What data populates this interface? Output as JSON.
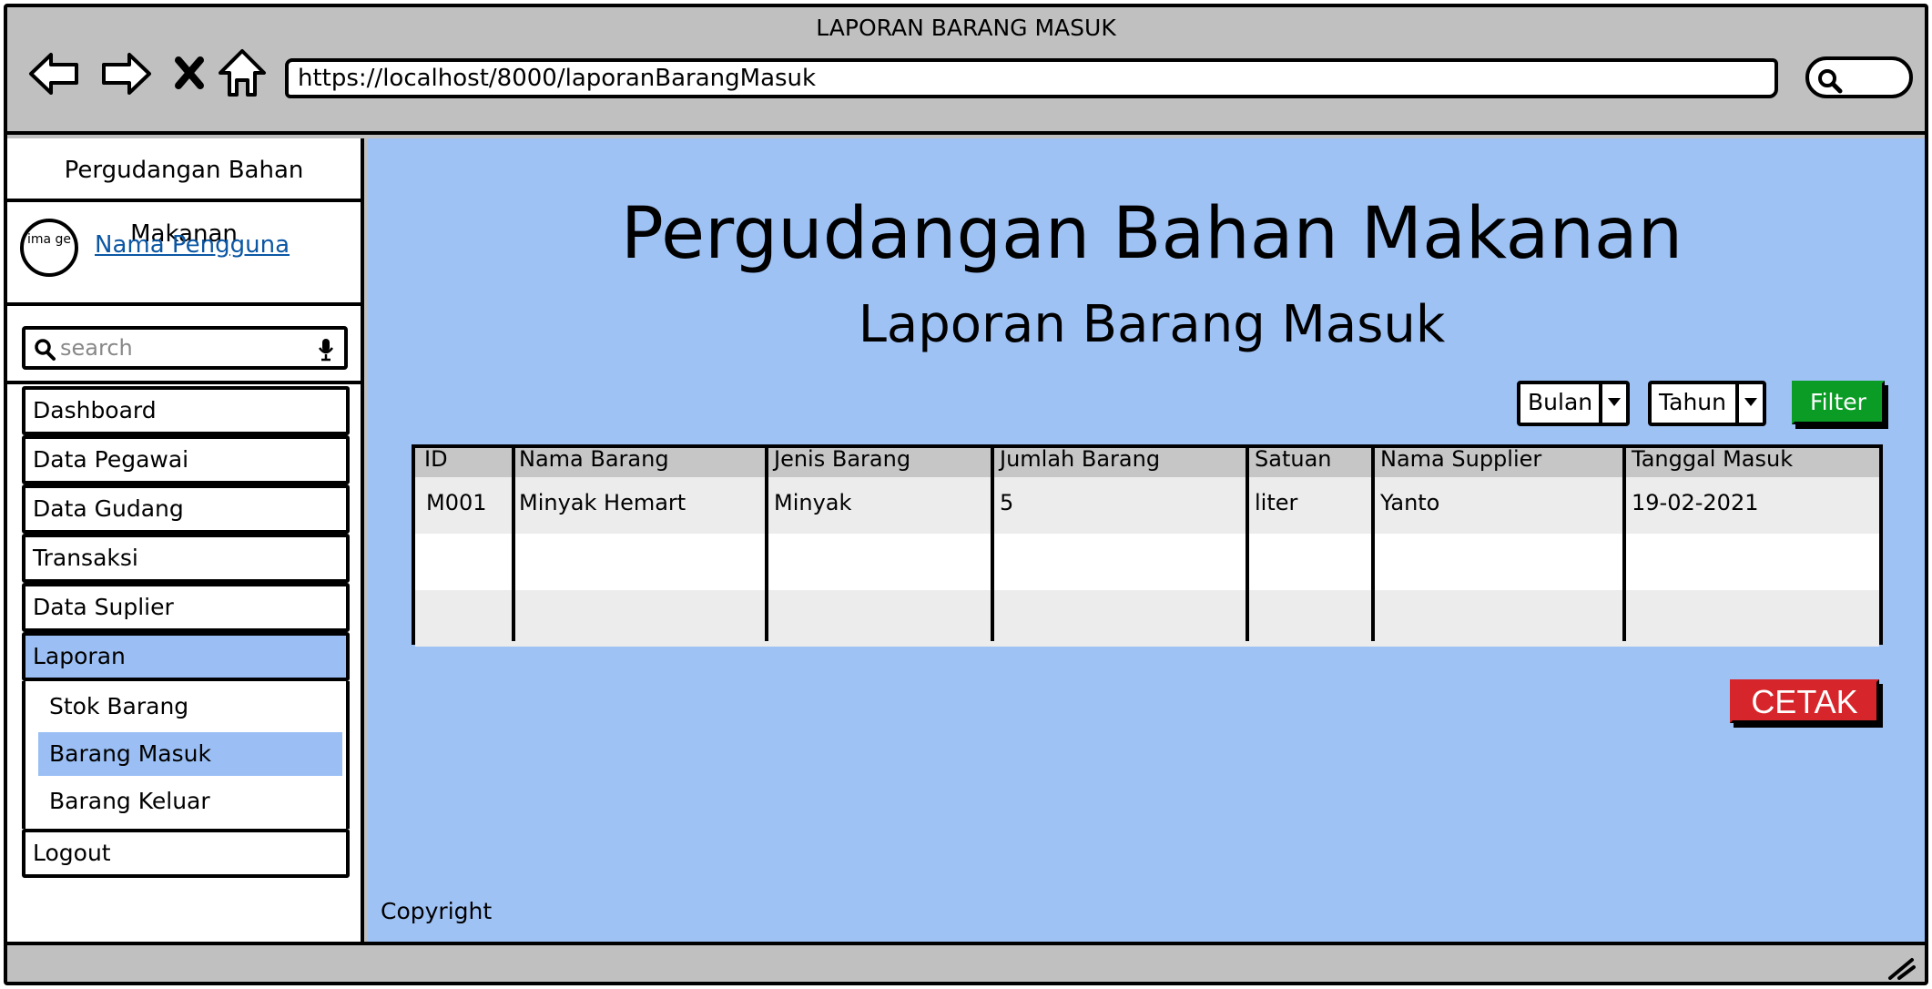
{
  "window": {
    "title": "LAPORAN BARANG MASUK",
    "url": "https://localhost/8000/laporanBarangMasuk"
  },
  "sidebar": {
    "brand": "Pergudangan Bahan Makanan",
    "avatar_text": "ima ge",
    "user_name": "Nama Pengguna",
    "search_placeholder": "search",
    "menu": [
      {
        "label": "Dashboard"
      },
      {
        "label": "Data Pegawai"
      },
      {
        "label": "Data Gudang"
      },
      {
        "label": "Transaksi"
      },
      {
        "label": "Data Suplier"
      },
      {
        "label": "Laporan",
        "active": true
      }
    ],
    "submenu": [
      {
        "label": "Stok Barang"
      },
      {
        "label": "Barang Masuk",
        "active": true
      },
      {
        "label": "Barang Keluar"
      }
    ],
    "logout": "Logout"
  },
  "main": {
    "title": "Pergudangan Bahan Makanan",
    "subtitle": "Laporan Barang Masuk",
    "filters": {
      "month_label": "Bulan",
      "year_label": "Tahun",
      "filter_button": "Filter"
    },
    "table": {
      "headers": [
        "ID",
        "Nama Barang",
        "Jenis Barang",
        "Jumlah Barang",
        "Satuan",
        "Nama Supplier",
        "Tanggal Masuk"
      ],
      "rows": [
        [
          "M001",
          "Minyak Hemart",
          "Minyak",
          "5",
          "liter",
          "Yanto",
          "19-02-2021"
        ]
      ]
    },
    "print_button": "CETAK",
    "footer": "Copyright"
  },
  "colors": {
    "main_bg": "#9fc2f5",
    "active_item": "#9bbff4",
    "filter_button": "#0a9c24",
    "print_button": "#d7262b",
    "chrome": "#c0c0c0"
  },
  "icons": [
    "back-arrow-icon",
    "forward-arrow-icon",
    "stop-icon",
    "home-icon",
    "search-icon",
    "microphone-icon",
    "dropdown-arrow-icon",
    "resize-grip-icon"
  ]
}
